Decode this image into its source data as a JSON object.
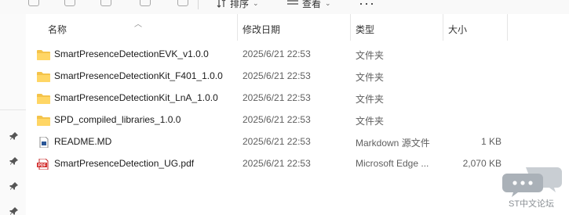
{
  "toolbar": {
    "sort_label": "排序",
    "view_label": "查看",
    "more_label": "···"
  },
  "columns": {
    "name": "名称",
    "date": "修改日期",
    "type": "类型",
    "size": "大小"
  },
  "files": [
    {
      "name": "SmartPresenceDetectionEVK_v1.0.0",
      "date": "2025/6/21 22:53",
      "type": "文件夹",
      "size": "",
      "icon": "folder-icon"
    },
    {
      "name": "SmartPresenceDetectionKit_F401_1.0.0",
      "date": "2025/6/21 22:53",
      "type": "文件夹",
      "size": "",
      "icon": "folder-icon"
    },
    {
      "name": "SmartPresenceDetectionKit_LnA_1.0.0",
      "date": "2025/6/21 22:53",
      "type": "文件夹",
      "size": "",
      "icon": "folder-icon"
    },
    {
      "name": "SPD_compiled_libraries_1.0.0",
      "date": "2025/6/21 22:53",
      "type": "文件夹",
      "size": "",
      "icon": "folder-icon"
    },
    {
      "name": "README.MD",
      "date": "2025/6/21 22:53",
      "type": "Markdown 源文件",
      "size": "1 KB",
      "icon": "markdown-file-icon"
    },
    {
      "name": "SmartPresenceDetection_UG.pdf",
      "date": "2025/6/21 22:53",
      "type": "Microsoft Edge ...",
      "size": "2,070 KB",
      "icon": "pdf-file-icon"
    }
  ],
  "watermark": {
    "text": "ST中文论坛"
  },
  "colors": {
    "folder": "#f4c34a",
    "pdf": "#d32f2f",
    "watermark": "#8a8f94"
  }
}
